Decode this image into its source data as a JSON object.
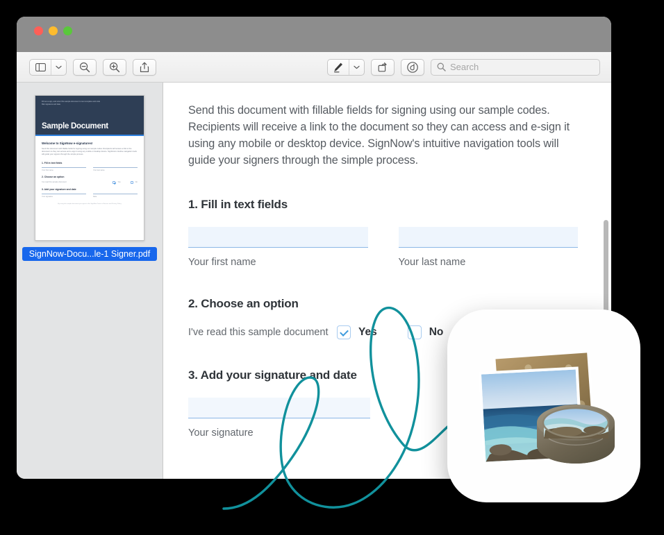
{
  "window": {
    "traffic_lights": [
      {
        "name": "close",
        "color": "#ff5f57"
      },
      {
        "name": "minimize",
        "color": "#febc2e"
      },
      {
        "name": "zoom",
        "color": "#5ac83b"
      }
    ],
    "titlebar_color": "#8d8d8d"
  },
  "toolbar": {
    "sidebar_toggle": "sidebar-view",
    "sidebar_menu": "chevron-down",
    "zoom_out": "zoom-out",
    "zoom_in": "zoom-in",
    "share": "share",
    "markup": "markup-pen",
    "markup_menu": "chevron-down",
    "rotate": "rotate",
    "annotate": "annotate",
    "search_placeholder": "Search",
    "search_value": ""
  },
  "sidebar": {
    "filename": "SignNow-Docu...le-1 Signer.pdf",
    "selected": true,
    "thumbnail": {
      "kicker": "Fill out a sign, and enter this sample document to test complete and code filler signature and date.",
      "title": "Sample Document",
      "heading": "Welcome to SignNow e-signatures!",
      "paragraph": "Send this document with fillable fields for signing using our sample codes. Recipients will receive a link to the document so they can access and e-sign it using any mobile or desktop device. SignNow's intuitive navigation tools will guide your signers through the simple process.",
      "sections": [
        "1. Fill in text fields",
        "2. Choose an option",
        "3. Add your signature and date"
      ],
      "field_labels": [
        "Your first name",
        "Your last name",
        "Your signature",
        "Date"
      ],
      "option_label": "I've read this sample document",
      "options": [
        "Yes",
        "No"
      ],
      "footer": "By using this sample document you agree to the SignNow Terms of Service and Privacy Policy",
      "footer_link": "Privacy Policy",
      "header_color": "#2e3e55",
      "accent_color": "#2f82e0"
    }
  },
  "document": {
    "intro": "Send this document with fillable fields for signing using our sample codes. Recipients will receive a link to the document so they can access and e-sign it using any mobile or desktop device. SignNow's intuitive navigation tools will guide your signers through the simple process.",
    "steps": [
      {
        "heading": "1. Fill in text fields",
        "fields": [
          {
            "label": "Your first name",
            "value": ""
          },
          {
            "label": "Your last name",
            "value": ""
          }
        ]
      },
      {
        "heading": "2. Choose an option",
        "prompt": "I've read this sample document",
        "choices": [
          {
            "label": "Yes",
            "checked": true
          },
          {
            "label": "No",
            "checked": false
          }
        ]
      },
      {
        "heading": "3. Add your signature and date",
        "fields": [
          {
            "label": "Your signature",
            "value": ""
          }
        ]
      }
    ],
    "field_fill_color": "#eef5fd",
    "field_underline_color": "#8ab6e6",
    "checkbox_accent": "#3e9bdd"
  },
  "annotation": {
    "type": "handwritten-signature",
    "color": "#11919c",
    "stroke_width": 3.4
  },
  "app_icon": {
    "name": "preview-app-icon",
    "label": "Preview",
    "background": "#fefefe"
  }
}
